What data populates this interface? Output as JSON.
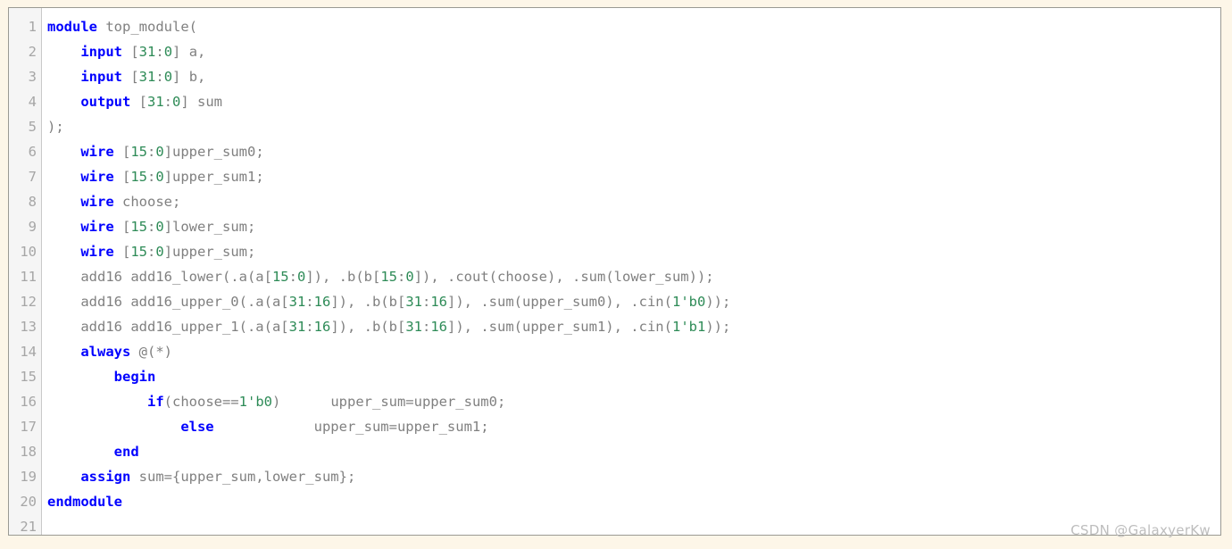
{
  "editor": {
    "language": "verilog",
    "background_color": "#ffffff",
    "gutter_color": "#f5f5f5",
    "page_background_color": "#fdf6e8",
    "keyword_color": "#0000ff",
    "number_color": "#2e8b57",
    "text_color": "#808080",
    "line_number_color": "#a6a6a6",
    "total_lines": 21,
    "line_numbers": [
      "1",
      "2",
      "3",
      "4",
      "5",
      "6",
      "7",
      "8",
      "9",
      "10",
      "11",
      "12",
      "13",
      "14",
      "15",
      "16",
      "17",
      "18",
      "19",
      "20",
      "21"
    ],
    "lines": [
      {
        "n": "1",
        "indent": "",
        "tokens": [
          {
            "t": "module",
            "k": "kw"
          },
          {
            "t": " top_module(",
            "k": "pl"
          }
        ]
      },
      {
        "n": "2",
        "indent": "    ",
        "tokens": [
          {
            "t": "input",
            "k": "kw"
          },
          {
            "t": " [",
            "k": "pl"
          },
          {
            "t": "31",
            "k": "num"
          },
          {
            "t": ":",
            "k": "pl"
          },
          {
            "t": "0",
            "k": "num"
          },
          {
            "t": "] a,",
            "k": "pl"
          }
        ]
      },
      {
        "n": "3",
        "indent": "    ",
        "tokens": [
          {
            "t": "input",
            "k": "kw"
          },
          {
            "t": " [",
            "k": "pl"
          },
          {
            "t": "31",
            "k": "num"
          },
          {
            "t": ":",
            "k": "pl"
          },
          {
            "t": "0",
            "k": "num"
          },
          {
            "t": "] b,",
            "k": "pl"
          }
        ]
      },
      {
        "n": "4",
        "indent": "    ",
        "tokens": [
          {
            "t": "output",
            "k": "kw"
          },
          {
            "t": " [",
            "k": "pl"
          },
          {
            "t": "31",
            "k": "num"
          },
          {
            "t": ":",
            "k": "pl"
          },
          {
            "t": "0",
            "k": "num"
          },
          {
            "t": "] sum",
            "k": "pl"
          }
        ]
      },
      {
        "n": "5",
        "indent": "",
        "tokens": [
          {
            "t": ");",
            "k": "pl"
          }
        ]
      },
      {
        "n": "6",
        "indent": "    ",
        "tokens": [
          {
            "t": "wire",
            "k": "kw"
          },
          {
            "t": " [",
            "k": "pl"
          },
          {
            "t": "15",
            "k": "num"
          },
          {
            "t": ":",
            "k": "pl"
          },
          {
            "t": "0",
            "k": "num"
          },
          {
            "t": "]upper_sum0;",
            "k": "pl"
          }
        ]
      },
      {
        "n": "7",
        "indent": "    ",
        "tokens": [
          {
            "t": "wire",
            "k": "kw"
          },
          {
            "t": " [",
            "k": "pl"
          },
          {
            "t": "15",
            "k": "num"
          },
          {
            "t": ":",
            "k": "pl"
          },
          {
            "t": "0",
            "k": "num"
          },
          {
            "t": "]upper_sum1;",
            "k": "pl"
          }
        ]
      },
      {
        "n": "8",
        "indent": "    ",
        "tokens": [
          {
            "t": "wire",
            "k": "kw"
          },
          {
            "t": " choose;",
            "k": "pl"
          }
        ]
      },
      {
        "n": "9",
        "indent": "    ",
        "tokens": [
          {
            "t": "wire",
            "k": "kw"
          },
          {
            "t": " [",
            "k": "pl"
          },
          {
            "t": "15",
            "k": "num"
          },
          {
            "t": ":",
            "k": "pl"
          },
          {
            "t": "0",
            "k": "num"
          },
          {
            "t": "]lower_sum;",
            "k": "pl"
          }
        ]
      },
      {
        "n": "10",
        "indent": "    ",
        "tokens": [
          {
            "t": "wire",
            "k": "kw"
          },
          {
            "t": " [",
            "k": "pl"
          },
          {
            "t": "15",
            "k": "num"
          },
          {
            "t": ":",
            "k": "pl"
          },
          {
            "t": "0",
            "k": "num"
          },
          {
            "t": "]upper_sum;",
            "k": "pl"
          }
        ]
      },
      {
        "n": "11",
        "indent": "    ",
        "tokens": [
          {
            "t": "add16 add16_lower(.a(a[",
            "k": "pl"
          },
          {
            "t": "15",
            "k": "num"
          },
          {
            "t": ":",
            "k": "pl"
          },
          {
            "t": "0",
            "k": "num"
          },
          {
            "t": "]), .b(b[",
            "k": "pl"
          },
          {
            "t": "15",
            "k": "num"
          },
          {
            "t": ":",
            "k": "pl"
          },
          {
            "t": "0",
            "k": "num"
          },
          {
            "t": "]), .cout(choose), .sum(lower_sum));",
            "k": "pl"
          }
        ]
      },
      {
        "n": "12",
        "indent": "    ",
        "tokens": [
          {
            "t": "add16 add16_upper_0(.a(a[",
            "k": "pl"
          },
          {
            "t": "31",
            "k": "num"
          },
          {
            "t": ":",
            "k": "pl"
          },
          {
            "t": "16",
            "k": "num"
          },
          {
            "t": "]), .b(b[",
            "k": "pl"
          },
          {
            "t": "31",
            "k": "num"
          },
          {
            "t": ":",
            "k": "pl"
          },
          {
            "t": "16",
            "k": "num"
          },
          {
            "t": "]), .sum(upper_sum0), .cin(",
            "k": "pl"
          },
          {
            "t": "1",
            "k": "num"
          },
          {
            "t": "'b0",
            "k": "num"
          },
          {
            "t": "));",
            "k": "pl"
          }
        ]
      },
      {
        "n": "13",
        "indent": "    ",
        "tokens": [
          {
            "t": "add16 add16_upper_1(.a(a[",
            "k": "pl"
          },
          {
            "t": "31",
            "k": "num"
          },
          {
            "t": ":",
            "k": "pl"
          },
          {
            "t": "16",
            "k": "num"
          },
          {
            "t": "]), .b(b[",
            "k": "pl"
          },
          {
            "t": "31",
            "k": "num"
          },
          {
            "t": ":",
            "k": "pl"
          },
          {
            "t": "16",
            "k": "num"
          },
          {
            "t": "]), .sum(upper_sum1), .cin(",
            "k": "pl"
          },
          {
            "t": "1",
            "k": "num"
          },
          {
            "t": "'b1",
            "k": "num"
          },
          {
            "t": "));",
            "k": "pl"
          }
        ]
      },
      {
        "n": "14",
        "indent": "    ",
        "tokens": [
          {
            "t": "always",
            "k": "kw"
          },
          {
            "t": " @(*)",
            "k": "pl"
          }
        ]
      },
      {
        "n": "15",
        "indent": "        ",
        "tokens": [
          {
            "t": "begin",
            "k": "kw"
          }
        ]
      },
      {
        "n": "16",
        "indent": "            ",
        "tokens": [
          {
            "t": "if",
            "k": "kw"
          },
          {
            "t": "(choose==",
            "k": "pl"
          },
          {
            "t": "1",
            "k": "num"
          },
          {
            "t": "'b0",
            "k": "num"
          },
          {
            "t": ")      upper_sum=upper_sum0;",
            "k": "pl"
          }
        ]
      },
      {
        "n": "17",
        "indent": "                ",
        "tokens": [
          {
            "t": "else",
            "k": "kw"
          },
          {
            "t": "            upper_sum=upper_sum1;",
            "k": "pl"
          }
        ]
      },
      {
        "n": "18",
        "indent": "        ",
        "tokens": [
          {
            "t": "end",
            "k": "kw"
          }
        ]
      },
      {
        "n": "19",
        "indent": "    ",
        "tokens": [
          {
            "t": "assign",
            "k": "kw"
          },
          {
            "t": " sum={upper_sum,lower_sum};",
            "k": "pl"
          }
        ]
      },
      {
        "n": "20",
        "indent": "",
        "tokens": [
          {
            "t": "endmodule",
            "k": "kw"
          }
        ]
      },
      {
        "n": "21",
        "indent": "",
        "tokens": [
          {
            "t": "",
            "k": "pl"
          }
        ]
      }
    ]
  },
  "watermark": {
    "text": "CSDN @GalaxyerKw"
  }
}
